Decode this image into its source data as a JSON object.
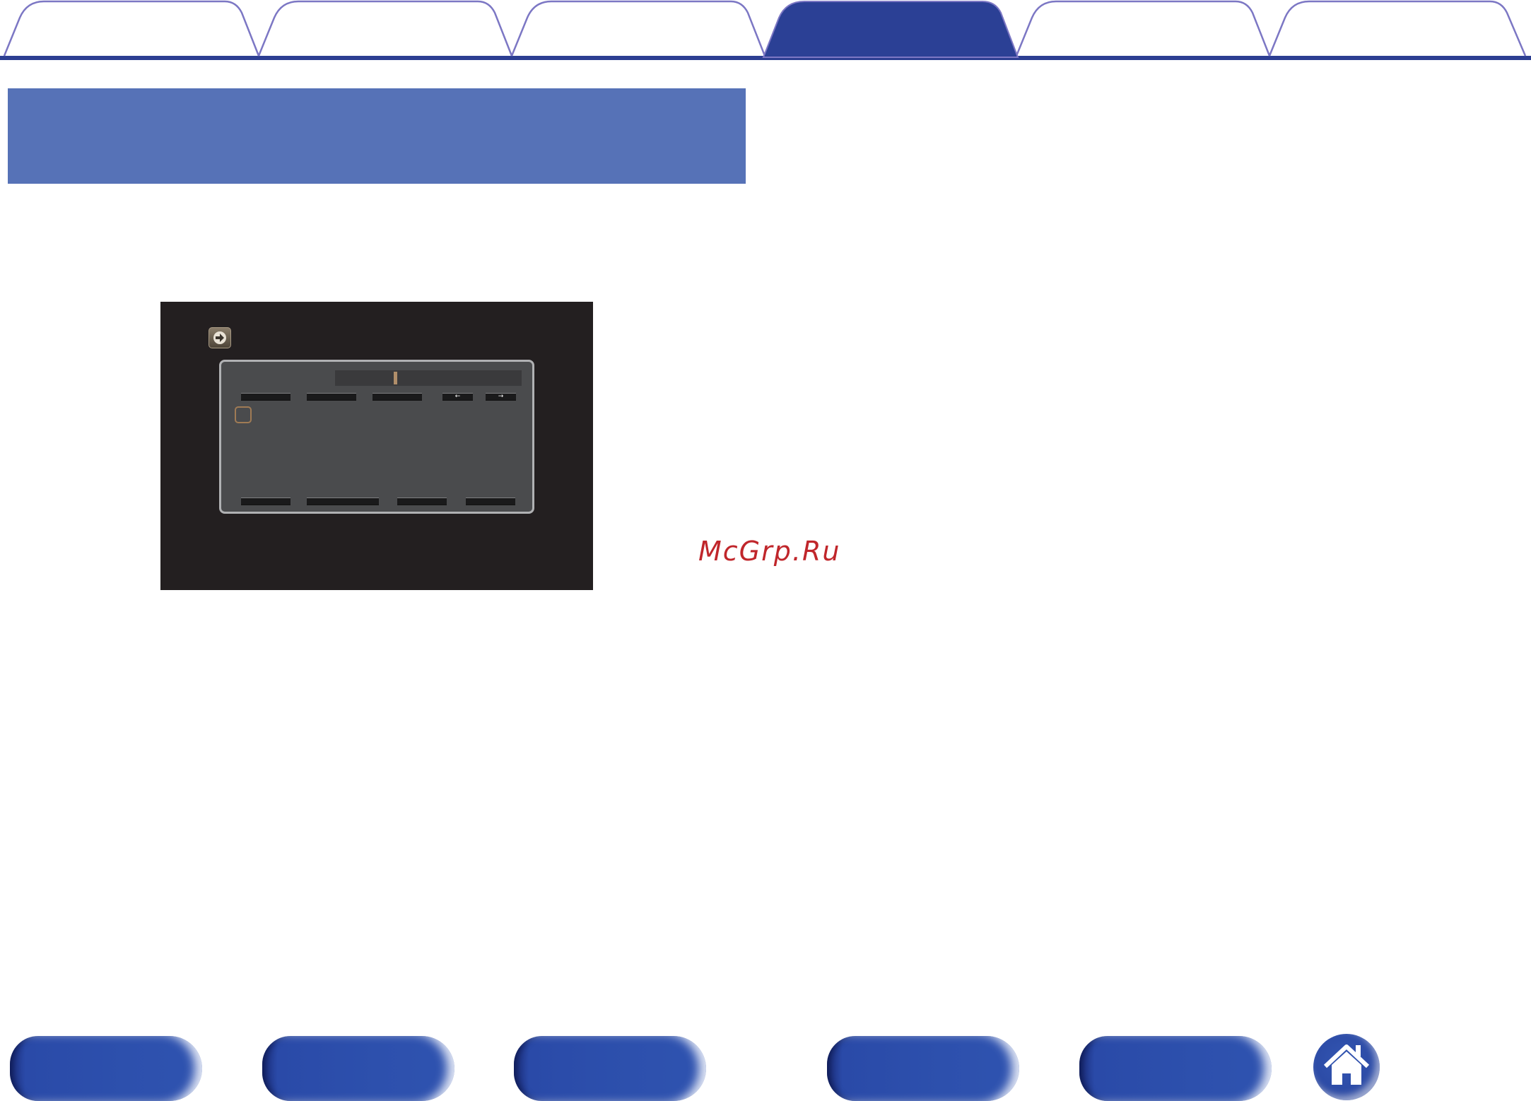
{
  "watermark": {
    "text": "McGrp.Ru"
  },
  "colors": {
    "tab_active": "#2b4095",
    "tab_outline": "#7c77c4",
    "rule": "#2c3e92",
    "section_bar": "#5672b7",
    "screen_bg": "#231f20",
    "dialog_bg": "#4a4b4d",
    "nav_button": "#2d50ad",
    "watermark": "#c0262b"
  },
  "tabs": {
    "count": 6,
    "active_index": 3
  },
  "screen": {
    "icon": "input-arrow-icon",
    "keys_top": [
      "",
      "",
      "",
      "←",
      "→"
    ],
    "keys_bottom": [
      "",
      "",
      "",
      ""
    ]
  },
  "nav": {
    "buttons": [
      "",
      "",
      "",
      "",
      ""
    ],
    "home_icon": "home-icon"
  }
}
